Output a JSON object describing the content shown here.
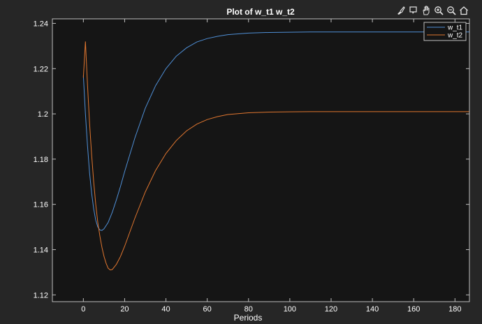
{
  "toolbar": {
    "icons": [
      "brush-icon",
      "data-tips-icon",
      "pan-icon",
      "zoom-in-icon",
      "zoom-out-icon",
      "home-icon"
    ]
  },
  "colors": {
    "background": "#262626",
    "axes_bg": "#151515",
    "axis": "#bfbfbf",
    "text": "#ffffff",
    "w_t1": "#4f8fd6",
    "w_t2": "#e0762f"
  },
  "chart_data": {
    "type": "line",
    "title": "Plot of w_t1 w_t2",
    "xlabel": "Periods",
    "ylabel": "",
    "xlim": [
      -15,
      187
    ],
    "ylim": [
      1.117,
      1.242
    ],
    "xticks": [
      0,
      20,
      40,
      60,
      80,
      100,
      120,
      140,
      160,
      180
    ],
    "xtick_labels": [
      "0",
      "20",
      "40",
      "60",
      "80",
      "100",
      "120",
      "140",
      "160",
      "180"
    ],
    "yticks": [
      1.12,
      1.14,
      1.16,
      1.18,
      1.2,
      1.22,
      1.24
    ],
    "ytick_labels": [
      "1.12",
      "1.14",
      "1.16",
      "1.18",
      "1.2",
      "1.22",
      "1.24"
    ],
    "grid": false,
    "legend_position": "top-right",
    "series": [
      {
        "name": "w_t1",
        "color": "#4f8fd6",
        "x": [
          0,
          1,
          2,
          3,
          4,
          5,
          6,
          7,
          8,
          9,
          10,
          12,
          14,
          16,
          18,
          20,
          25,
          30,
          35,
          40,
          45,
          50,
          55,
          60,
          65,
          70,
          80,
          90,
          100,
          110,
          120,
          140,
          160,
          187
        ],
        "y": [
          1.217,
          1.2,
          1.186,
          1.174,
          1.165,
          1.158,
          1.153,
          1.15,
          1.1487,
          1.1485,
          1.1492,
          1.152,
          1.1565,
          1.162,
          1.168,
          1.1745,
          1.1895,
          1.2025,
          1.2125,
          1.22,
          1.2255,
          1.2292,
          1.2318,
          1.2333,
          1.2343,
          1.235,
          1.2357,
          1.236,
          1.2361,
          1.2362,
          1.2362,
          1.2362,
          1.2362,
          1.2362
        ]
      },
      {
        "name": "w_t2",
        "color": "#e0762f",
        "x": [
          0,
          1,
          2,
          3,
          4,
          5,
          6,
          7,
          8,
          9,
          10,
          11,
          12,
          13,
          14,
          16,
          18,
          20,
          25,
          30,
          35,
          40,
          45,
          50,
          55,
          60,
          65,
          70,
          80,
          90,
          100,
          110,
          120,
          140,
          160,
          187
        ],
        "y": [
          1.216,
          1.232,
          1.213,
          1.196,
          1.182,
          1.17,
          1.16,
          1.152,
          1.146,
          1.141,
          1.137,
          1.134,
          1.1318,
          1.131,
          1.1312,
          1.1335,
          1.137,
          1.1415,
          1.154,
          1.1655,
          1.175,
          1.1825,
          1.1882,
          1.1925,
          1.1955,
          1.1975,
          1.1988,
          1.1997,
          1.2005,
          1.2008,
          1.2009,
          1.201,
          1.201,
          1.201,
          1.201,
          1.201
        ]
      }
    ]
  }
}
